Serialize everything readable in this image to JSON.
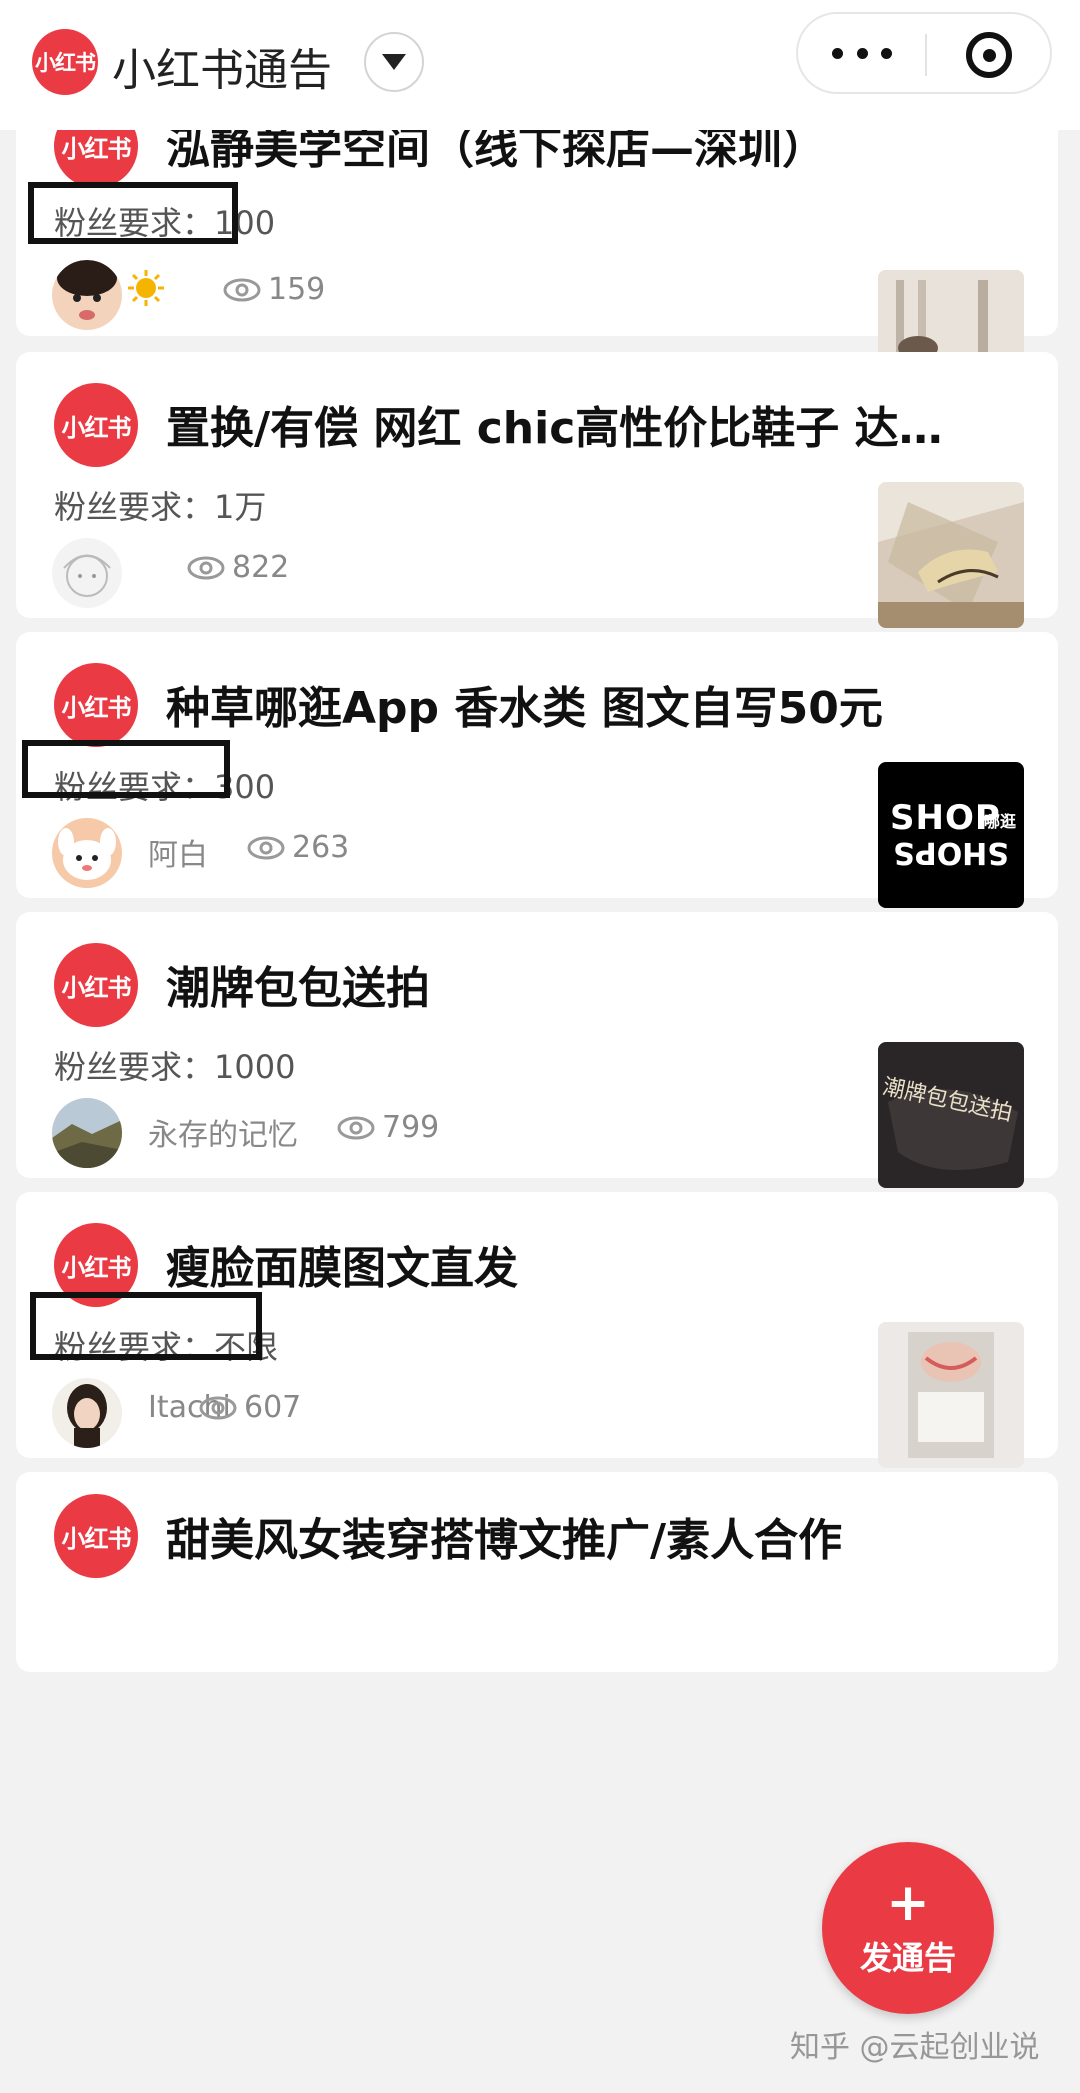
{
  "topbar": {
    "logo_text": "小红书",
    "title": "小红书通告"
  },
  "colors": {
    "brand_red": "#ea3b45",
    "box_outline": "#111111"
  },
  "cards": [
    {
      "logo_text": "小红书",
      "title": "泓静美学空间（线下探店—深圳）",
      "requirement": "粉丝要求：100",
      "author": "",
      "views": "159",
      "highlighted": true
    },
    {
      "logo_text": "小红书",
      "title": "置换/有偿 网红 chic高性价比鞋子 达…",
      "requirement": "粉丝要求：1万",
      "author": "",
      "views": "822",
      "highlighted": false
    },
    {
      "logo_text": "小红书",
      "title": "种草哪逛App 香水类 图文自写50元",
      "requirement": "粉丝要求：300",
      "author": "阿白",
      "views": "263",
      "highlighted": true,
      "thumb_text_top": "SHOP",
      "thumb_text_side": "哪逛",
      "thumb_text_bottom": "SHOPS"
    },
    {
      "logo_text": "小红书",
      "title": "潮牌包包送拍",
      "requirement": "粉丝要求：1000",
      "author": "永存的记忆",
      "views": "799",
      "highlighted": false,
      "thumb_text": "潮牌包包送拍"
    },
    {
      "logo_text": "小红书",
      "title": "瘦脸面膜图文直发",
      "requirement": "粉丝要求：不限",
      "author": "Itachi",
      "views": "607",
      "highlighted": true
    },
    {
      "logo_text": "小红书",
      "title": "甜美风女装穿搭博文推广/素人合作"
    }
  ],
  "fab": {
    "icon": "plus-icon",
    "label": "发通告"
  },
  "watermark": "知乎 @云起创业说"
}
